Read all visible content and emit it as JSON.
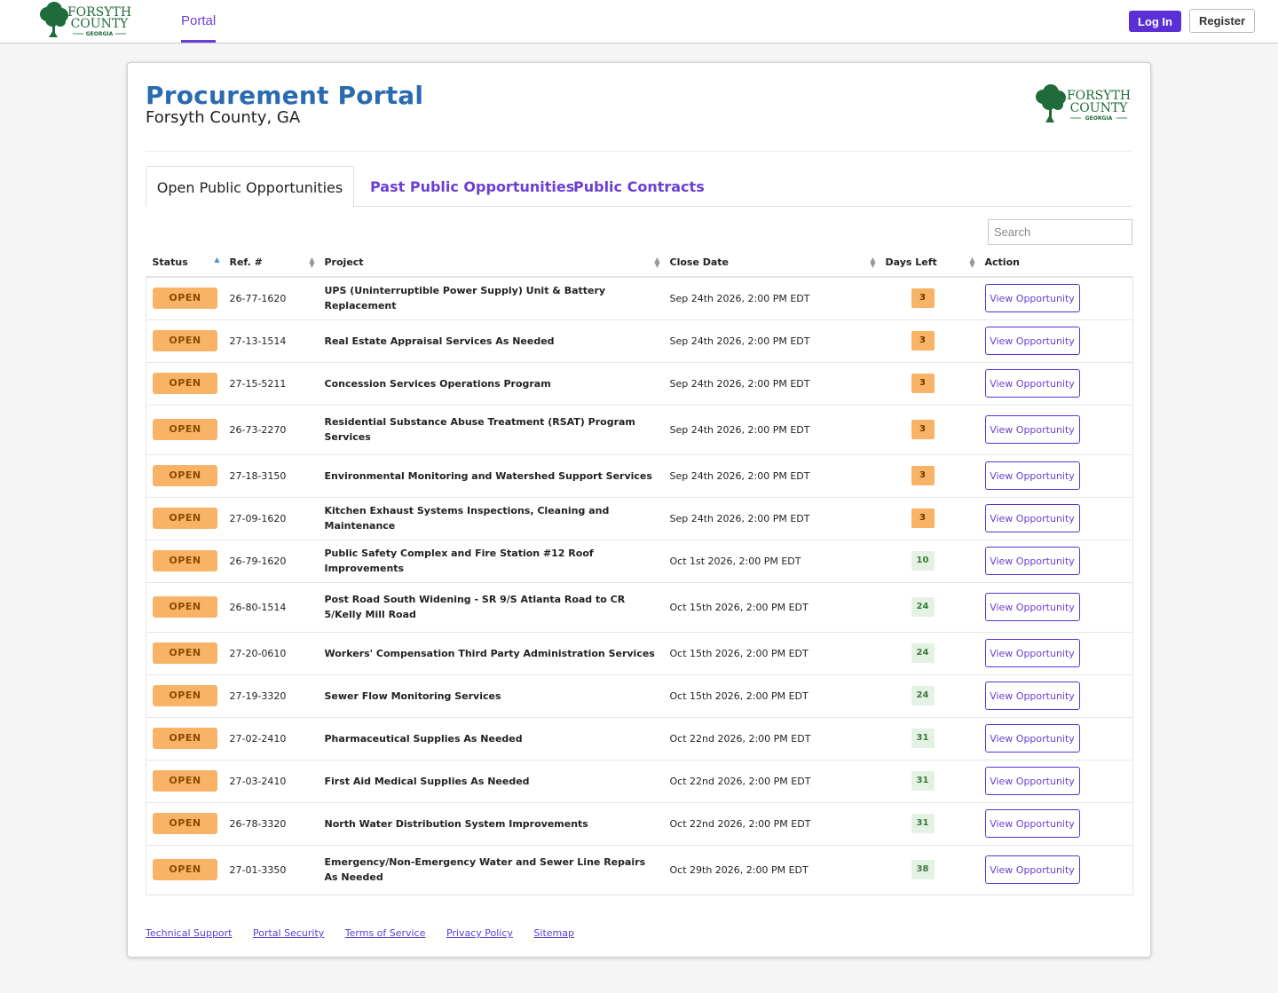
{
  "nav": {
    "logo_text": [
      "FORSYTH",
      "COUNTY",
      "GEORGIA"
    ],
    "portal_tab": "Portal",
    "login_label": "Log In",
    "register_label": "Register"
  },
  "header": {
    "title": "Procurement Portal",
    "subtitle": "Forsyth County, GA"
  },
  "tabs": [
    {
      "label": "Open Public Opportunities",
      "active": true
    },
    {
      "label": "Past Public Opportunities",
      "active": false
    },
    {
      "label": "Public Contracts",
      "active": false
    }
  ],
  "search": {
    "placeholder": "Search"
  },
  "table": {
    "columns": [
      "Status",
      "Ref. #",
      "Project",
      "Close Date",
      "Days Left",
      "Action"
    ],
    "rows": [
      {
        "status": "OPEN",
        "ref": "26-77-1620",
        "project": "UPS (Uninterruptible Power Supply) Unit & Battery Replacement",
        "close": "Sep 24th 2026, 2:00 PM EDT",
        "days": "3",
        "action": "View Opportunity"
      },
      {
        "status": "OPEN",
        "ref": "27-13-1514",
        "project": "Real Estate Appraisal Services As Needed",
        "close": "Sep 24th 2026, 2:00 PM EDT",
        "days": "3",
        "action": "View Opportunity"
      },
      {
        "status": "OPEN",
        "ref": "27-15-5211",
        "project": "Concession Services Operations Program",
        "close": "Sep 24th 2026, 2:00 PM EDT",
        "days": "3",
        "action": "View Opportunity"
      },
      {
        "status": "OPEN",
        "ref": "26-73-2270",
        "project": "Residential Substance Abuse Treatment (RSAT) Program Services",
        "close": "Sep 24th 2026, 2:00 PM EDT",
        "days": "3",
        "action": "View Opportunity"
      },
      {
        "status": "OPEN",
        "ref": "27-18-3150",
        "project": "Environmental Monitoring and Watershed Support Services",
        "close": "Sep 24th 2026, 2:00 PM EDT",
        "days": "3",
        "action": "View Opportunity"
      },
      {
        "status": "OPEN",
        "ref": "27-09-1620",
        "project": "Kitchen Exhaust Systems Inspections, Cleaning and Maintenance",
        "close": "Sep 24th 2026, 2:00 PM EDT",
        "days": "3",
        "action": "View Opportunity"
      },
      {
        "status": "OPEN",
        "ref": "26-79-1620",
        "project": "Public Safety Complex and Fire Station #12 Roof Improvements",
        "close": "Oct 1st 2026, 2:00 PM EDT",
        "days": "10",
        "action": "View Opportunity"
      },
      {
        "status": "OPEN",
        "ref": "26-80-1514",
        "project": "Post Road South Widening - SR 9/S Atlanta Road to CR 5/Kelly Mill Road",
        "close": "Oct 15th 2026, 2:00 PM EDT",
        "days": "24",
        "action": "View Opportunity"
      },
      {
        "status": "OPEN",
        "ref": "27-20-0610",
        "project": "Workers' Compensation Third Party Administration Services",
        "close": "Oct 15th 2026, 2:00 PM EDT",
        "days": "24",
        "action": "View Opportunity"
      },
      {
        "status": "OPEN",
        "ref": "27-19-3320",
        "project": "Sewer Flow Monitoring Services",
        "close": "Oct 15th 2026, 2:00 PM EDT",
        "days": "24",
        "action": "View Opportunity"
      },
      {
        "status": "OPEN",
        "ref": "27-02-2410",
        "project": "Pharmaceutical Supplies As Needed",
        "close": "Oct 22nd 2026, 2:00 PM EDT",
        "days": "31",
        "action": "View Opportunity"
      },
      {
        "status": "OPEN",
        "ref": "27-03-2410",
        "project": "First Aid Medical Supplies As Needed",
        "close": "Oct 22nd 2026, 2:00 PM EDT",
        "days": "31",
        "action": "View Opportunity"
      },
      {
        "status": "OPEN",
        "ref": "26-78-3320",
        "project": "North Water Distribution System Improvements",
        "close": "Oct 22nd 2026, 2:00 PM EDT",
        "days": "31",
        "action": "View Opportunity"
      },
      {
        "status": "OPEN",
        "ref": "27-01-3350",
        "project": "Emergency/Non-Emergency Water and Sewer Line Repairs As Needed",
        "close": "Oct 29th 2026, 2:00 PM EDT",
        "days": "38",
        "action": "View Opportunity"
      }
    ]
  },
  "footer": {
    "links": [
      "Technical Support",
      "Portal Security",
      "Terms of Service",
      "Privacy Policy",
      "Sitemap"
    ]
  },
  "colors": {
    "accent": "#5a2fd6",
    "title_blue": "#2a6ab0",
    "status_orange": "#f8b366",
    "days_green_bg": "#e4f2e4",
    "logo_green": "#1f6b3a"
  },
  "icons": {
    "logo": "tree-logo-icon",
    "sort_asc": "sort-asc-icon",
    "sort_both": "sort-both-icon"
  }
}
